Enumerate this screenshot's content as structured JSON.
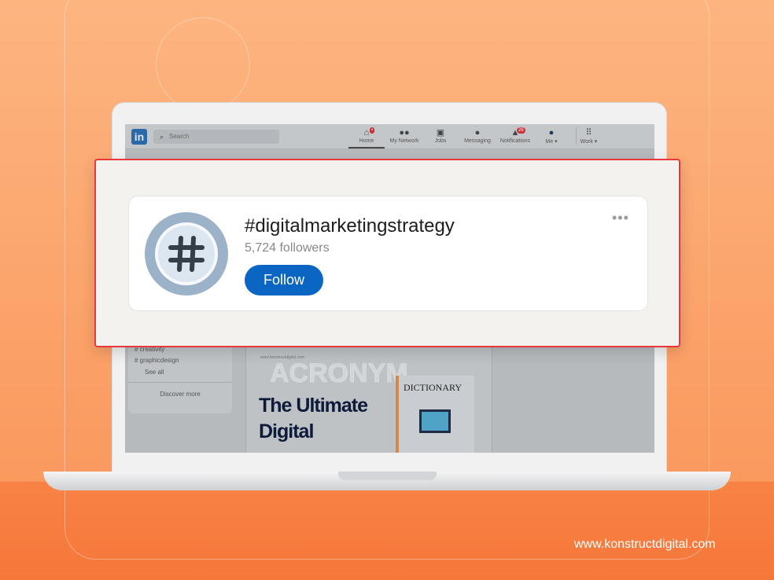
{
  "colors": {
    "accent": "#0a66c2",
    "highlight_border": "#e8383c",
    "background": "#fba46c"
  },
  "nav": {
    "logo": "in",
    "search_placeholder": "Search",
    "items": [
      {
        "label": "Home",
        "icon": "home-icon",
        "badge": "•"
      },
      {
        "label": "My Network",
        "icon": "network-icon"
      },
      {
        "label": "Jobs",
        "icon": "briefcase-icon"
      },
      {
        "label": "Messaging",
        "icon": "message-icon"
      },
      {
        "label": "Notifications",
        "icon": "bell-icon",
        "badge": "26"
      },
      {
        "label": "Me ▾",
        "icon": "avatar-icon"
      },
      {
        "label": "Work ▾",
        "icon": "grid-icon"
      }
    ]
  },
  "sidebar": {
    "hashtags": [
      "creativity",
      "graphicdesign"
    ],
    "see_all": "See all",
    "discover": "Discover more"
  },
  "post": {
    "watermark": "www.konstructdigital.com",
    "bg_text": "ACRONYM",
    "headline1": "The Ultimate",
    "headline2": "Digital",
    "book": "DICTIONARY"
  },
  "hashtag_card": {
    "title": "#digitalmarketingstrategy",
    "followers": "5,724 followers",
    "follow_label": "Follow",
    "more": "•••"
  },
  "footer": {
    "url": "www.konstructdigital.com"
  }
}
